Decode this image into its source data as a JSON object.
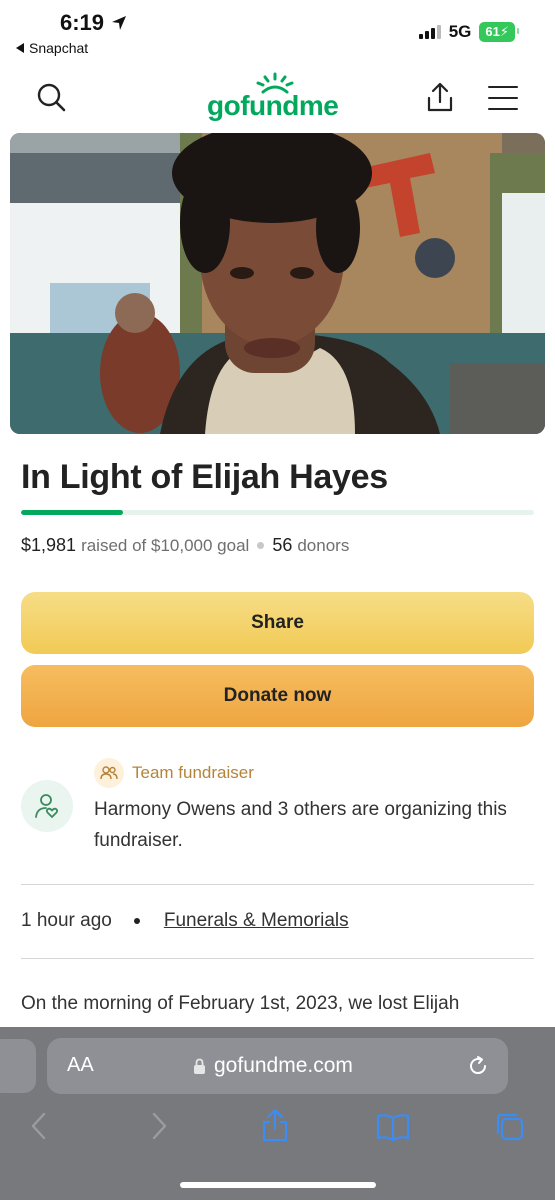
{
  "status_bar": {
    "time": "6:19",
    "back_app": "Snapchat",
    "network": "5G",
    "battery": "61"
  },
  "header": {
    "logo_text": "gofundme",
    "icons": [
      "search-icon",
      "share-icon",
      "menu-icon"
    ]
  },
  "campaign": {
    "title": "In Light of Elijah Hayes",
    "progress_fraction": 0.198,
    "raised": "$1,981",
    "raised_suffix": "raised of $10,000 goal",
    "donor_count": "56",
    "donor_label": "donors"
  },
  "actions": {
    "share_label": "Share",
    "donate_label": "Donate now"
  },
  "organizer": {
    "badge_label": "Team fundraiser",
    "text": "Harmony Owens and 3 others are organizing this fundraiser."
  },
  "meta": {
    "time_ago": "1 hour ago",
    "category": "Funerals & Memorials"
  },
  "story": {
    "first_line": "On the morning of February 1st, 2023, we lost Elijah"
  },
  "browser": {
    "aa_label": "AA",
    "url": "gofundme.com"
  },
  "colors": {
    "brand_green": "#02a95c",
    "share_button": "#f2ca55",
    "donate_button": "#eea540",
    "team_label": "#b5843a"
  }
}
